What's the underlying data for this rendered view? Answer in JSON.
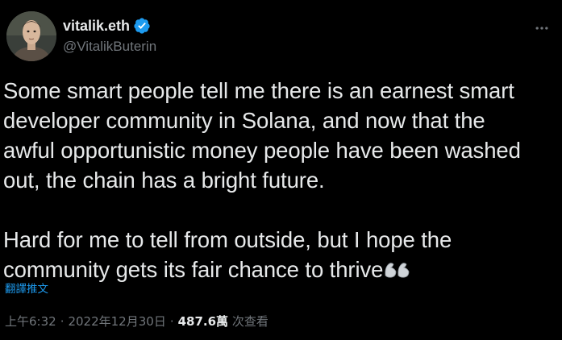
{
  "author": {
    "display_name": "vitalik.eth",
    "handle": "@VitalikButerin",
    "verified": true,
    "avatar_icon": "avatar-photo"
  },
  "header": {
    "more_icon": "more-options-icon"
  },
  "tweet": {
    "lines_paragraph1": [
      "Some smart people tell me there is an earnest smart",
      "developer community in Solana, and now that the",
      "awful opportunistic money people have been washed",
      "out, the chain has a bright future."
    ],
    "lines_paragraph2": [
      "Hard for me to tell from outside, but I hope the",
      "community gets its fair chance to thrive"
    ],
    "emoji": [
      "flexed-biceps-icon",
      "flexed-biceps-icon"
    ]
  },
  "translate": {
    "label": "翻譯推文"
  },
  "meta": {
    "time": "上午6:32",
    "separator": "·",
    "date": "2022年12月30日",
    "views_count": "487.6萬",
    "views_label": "次查看"
  },
  "colors": {
    "background": "#000000",
    "text_primary": "#e7e9ea",
    "text_secondary": "#71767b",
    "accent": "#1d9bf0"
  }
}
